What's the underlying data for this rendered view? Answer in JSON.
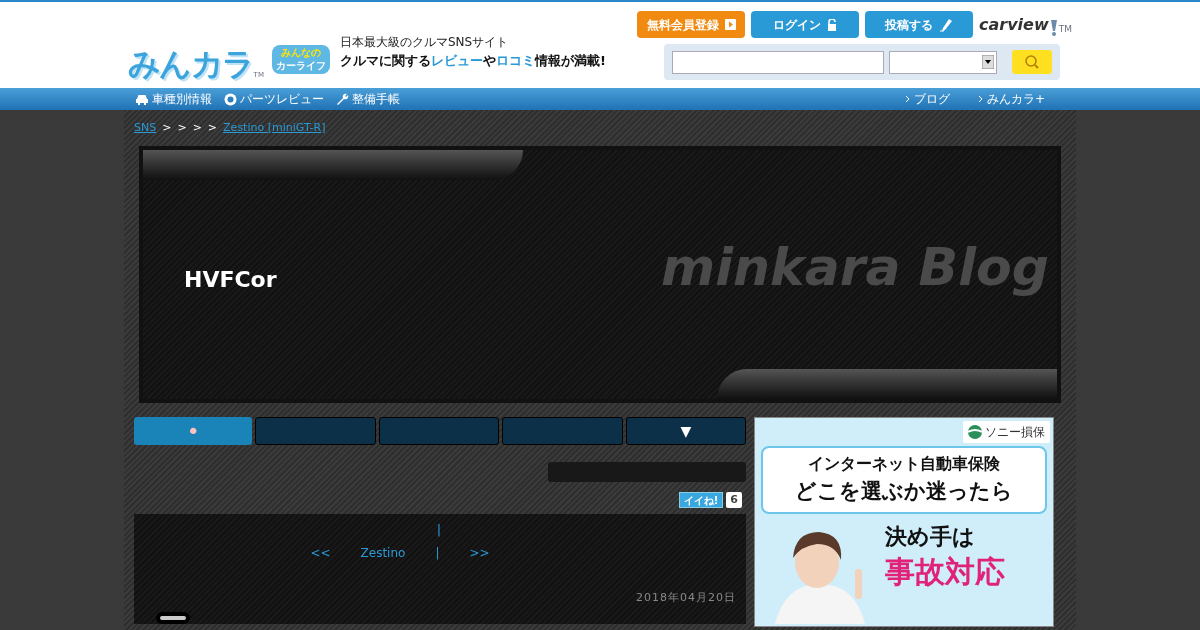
{
  "header": {
    "logo": "みんカラ",
    "logo_tm": "TM",
    "badge": [
      "みんなの",
      "カーライフ"
    ],
    "tagline": "日本最大級のクルマSNSサイト",
    "slogan": "クルマに関する**レビュー**や**ロコミ**情報が満載!",
    "buttons": [
      {
        "label": "無料会員登録",
        "kind": "register"
      },
      {
        "label": "ログイン",
        "kind": "login"
      },
      {
        "label": "投稿する",
        "kind": "post"
      }
    ],
    "brand": "carview",
    "brand_tm": "TM"
  },
  "nav": {
    "left": [
      {
        "label": "車種別情報",
        "kind": "car"
      },
      {
        "label": "パーツレビュー",
        "kind": "parts"
      },
      {
        "label": "整備手帳",
        "kind": "tool"
      }
    ],
    "right": [
      "ブログ",
      "みんカラ+"
    ]
  },
  "breadcrumb": {
    "items": [
      {
        "label": "SNS",
        "kind": "link"
      },
      {
        "label": ">",
        "kind": "sep"
      },
      {
        "label": ">",
        "kind": "sep"
      },
      {
        "label": ">",
        "kind": "sep"
      },
      {
        "label": ">",
        "kind": "sep"
      },
      {
        "label": "Zestino [miniGT-R]",
        "kind": "link"
      }
    ]
  },
  "banner": {
    "title": "HVFCor",
    "watermark": "minkara Blog"
  },
  "tabs": [
    {
      "label": "•",
      "selected": true
    },
    {
      "selected": false
    },
    {
      "selected": false
    },
    {
      "selected": false
    },
    {
      "label": "▼",
      "selected": false
    }
  ],
  "like": {
    "label": "イイね!",
    "count": "6"
  },
  "post": {
    "top": "|",
    "nav": [
      "<<",
      "Zestino",
      "|",
      ">>"
    ],
    "date": "2018年04月20日"
  },
  "ad": {
    "brand": "ソニー損保",
    "lines": [
      "インターネット自動車保険",
      "どこを選ぶか迷ったら"
    ],
    "lead": "決め手は",
    "emphasis": "事故対応"
  }
}
